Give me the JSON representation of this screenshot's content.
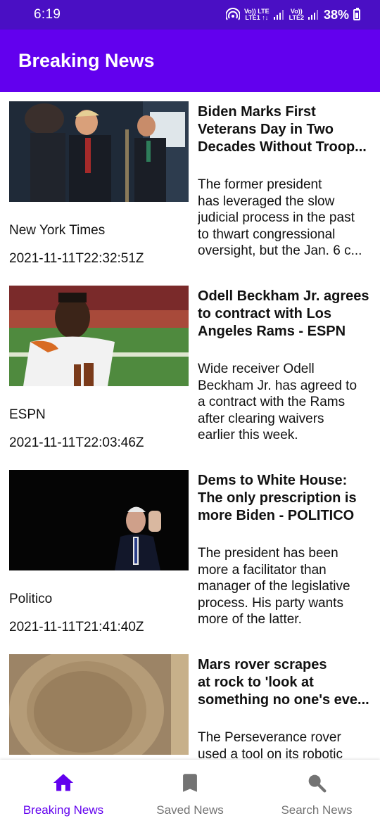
{
  "status_bar": {
    "time": "6:19",
    "sim1": "Vo)) LTE\nLTE1 ↑↓",
    "sim2": "Vo))\nLTE2",
    "battery": "38%"
  },
  "app_bar": {
    "title": "Breaking News"
  },
  "articles": [
    {
      "source": "New York Times",
      "date": "2021-11-11T22:32:51Z",
      "title": "Biden Marks First\nVeterans Day in Two\nDecades Without Troop...",
      "description": "The former president\nhas leveraged the slow\njudicial process in the past\nto thwart congressional\noversight, but the Jan. 6 c..."
    },
    {
      "source": "ESPN",
      "date": "2021-11-11T22:03:46Z",
      "title": "Odell Beckham Jr. agrees\nto contract with Los\nAngeles Rams - ESPN",
      "description": "Wide receiver Odell\nBeckham Jr. has agreed to\na contract with the Rams\nafter clearing waivers\nearlier this week."
    },
    {
      "source": "Politico",
      "date": "2021-11-11T21:41:40Z",
      "title": "Dems to White House:\nThe only prescription is\nmore Biden - POLITICO",
      "description": "The president has been\nmore a facilitator than\nmanager of the legislative\nprocess. His party wants\nmore of the latter."
    },
    {
      "source": "",
      "date": "",
      "title": "Mars rover scrapes\nat rock to 'look at\nsomething no one's eve...",
      "description": "The Perseverance rover\nused a tool on its robotic"
    }
  ],
  "bottom_nav": [
    {
      "label": "Breaking News",
      "icon": "home-icon",
      "active": true
    },
    {
      "label": "Saved News",
      "icon": "bookmark-icon",
      "active": false
    },
    {
      "label": "Search News",
      "icon": "search-icon",
      "active": false
    }
  ],
  "colors": {
    "status_bar": "#4a0fc4",
    "primary": "#6200ee",
    "nav_inactive": "#737373"
  }
}
